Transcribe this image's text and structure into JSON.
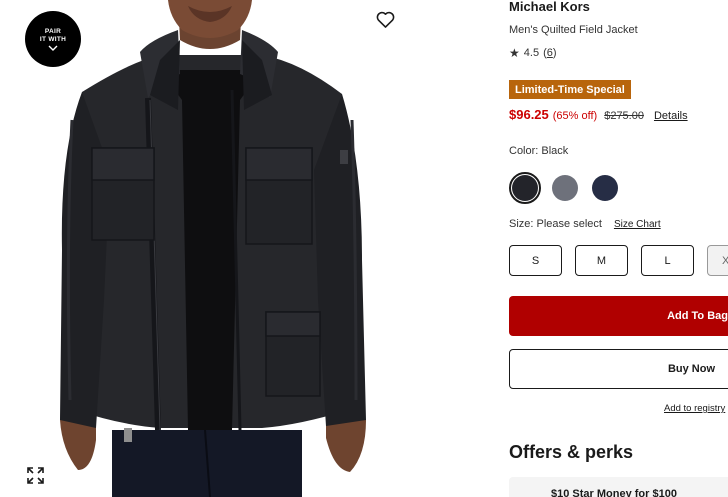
{
  "image": {
    "pair_badge": {
      "line1": "PAIR",
      "line2": "IT WITH"
    },
    "icons": [
      "heart-icon",
      "chevron-down-icon",
      "expand-icon"
    ]
  },
  "product": {
    "brand": "Michael Kors",
    "name": "Men's Quilted Field Jacket",
    "rating": {
      "star": "★",
      "value": "4.5",
      "count": "6"
    },
    "promo_badge": "Limited-Time Special",
    "price": {
      "sale": "$96.25",
      "discount": "(65% off)",
      "original": "$275.00",
      "details_link": "Details"
    },
    "color_label": "Color: Black",
    "colors": [
      {
        "name": "Black",
        "hex": "#23242a",
        "selected": true
      },
      {
        "name": "Gray",
        "hex": "#6e717b",
        "selected": false
      },
      {
        "name": "Navy",
        "hex": "#262d45",
        "selected": false
      }
    ],
    "size_label": "Size: Please select",
    "size_chart_link": "Size Chart",
    "sizes": [
      "S",
      "M",
      "L",
      "X"
    ]
  },
  "actions": {
    "add_to_bag": "Add To Bag",
    "buy_now": "Buy Now",
    "add_to_registry": "Add to registry"
  },
  "offers": {
    "heading": "Offers & perks",
    "first_offer": "$10 Star Money for $100"
  },
  "colors": {
    "sale_red": "#cc0000",
    "promo_badge_bg": "#b8650c",
    "add_to_bag_bg": "#b00000"
  }
}
